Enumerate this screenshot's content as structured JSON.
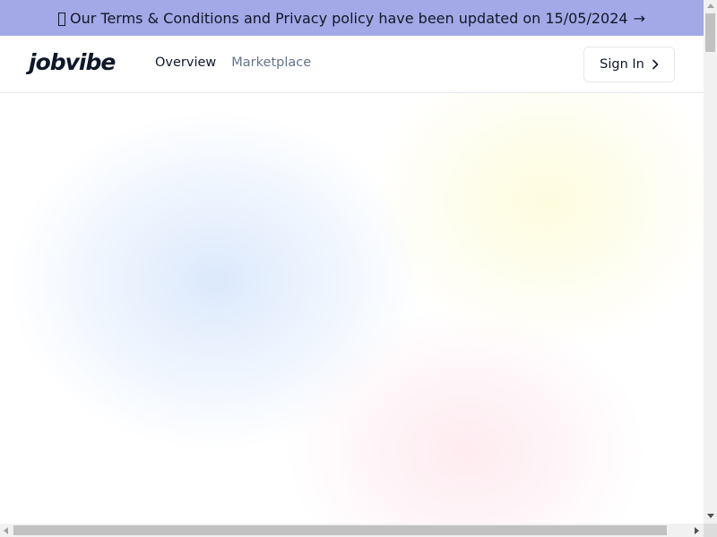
{
  "banner": {
    "text": "Our Terms & Conditions and Privacy policy have been updated on 15/05/2024",
    "arrow": "→",
    "leading_icon": "missing-glyph-box",
    "background": "#a3a8e6"
  },
  "header": {
    "logo": "jobvibe",
    "nav": [
      {
        "label": "Overview",
        "active": true
      },
      {
        "label": "Marketplace",
        "active": false
      }
    ],
    "signin": {
      "label": "Sign In",
      "icon": "chevron-right-icon"
    }
  },
  "hero": {
    "gradient_colors": [
      "#bed7fa",
      "#fcfac8",
      "#fdd7e1"
    ]
  },
  "scrollbars": {
    "vertical": true,
    "horizontal": true
  }
}
